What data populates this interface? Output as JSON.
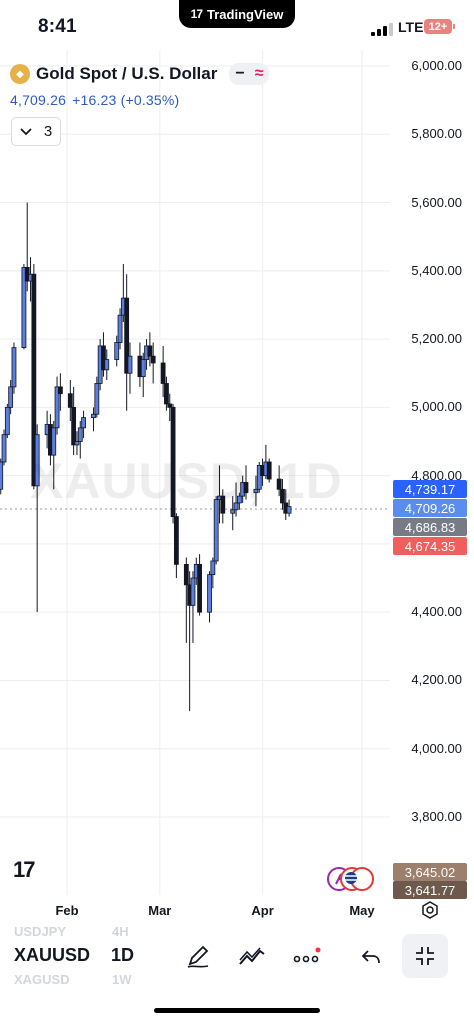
{
  "status": {
    "time": "8:41",
    "app_name": "TradingView",
    "network": "LTE",
    "battery": "12+"
  },
  "symbol": {
    "name": "Gold Spot / U.S. Dollar",
    "price": "4,709.26",
    "change": "+16.23 (+0.35%)",
    "indicator_count": "3"
  },
  "watermark": "XAUUSD, 1D",
  "price_tags": [
    {
      "label": "4,739.17",
      "color": "#2962ff"
    },
    {
      "label": "4,709.26",
      "color": "#5b8def"
    },
    {
      "label": "4,686.83",
      "color": "#787b86"
    },
    {
      "label": "4,674.35",
      "color": "#f05e5e"
    },
    {
      "label": "3,645.02",
      "color": "#9c7f6c"
    },
    {
      "label": "3,641.77",
      "color": "#6d5a4c"
    }
  ],
  "bottom": {
    "symbol": "XAUUSD",
    "interval": "1D",
    "ghost_above_symbol": "USDJPY",
    "ghost_above_interval": "4H",
    "ghost_below_symbol": "XAGUSD",
    "ghost_below_interval": "1W"
  },
  "colors": {
    "up": "#5b7fe0",
    "down": "#131722",
    "accent": "#2962ff"
  },
  "chart_data": {
    "type": "candlestick",
    "title": "Gold Spot / U.S. Dollar",
    "xlabel": "",
    "ylabel": "",
    "y_ticks": [
      6000,
      5800,
      5600,
      5400,
      5200,
      5000,
      4800,
      4600,
      4400,
      4200,
      4000,
      3800
    ],
    "y_tick_labels": [
      "6,000.00",
      "5,800.00",
      "5,600.00",
      "5,400.00",
      "5,200.00",
      "5,000.00",
      "4,800.00",
      "4,600.00",
      "4,400.00",
      "4,200.00",
      "4,000.00",
      "3,800.00"
    ],
    "ylim": [
      3700,
      6060
    ],
    "x_ticks": [
      {
        "label": "Feb",
        "date": "2026-02-01"
      },
      {
        "label": "Mar",
        "date": "2026-03-01"
      },
      {
        "label": "Apr",
        "date": "2026-04-01"
      },
      {
        "label": "May",
        "date": "2026-05-01"
      }
    ],
    "grid": true,
    "candles": [
      {
        "date": "2026-01-02",
        "o": 4630,
        "h": 4660,
        "l": 4610,
        "c": 4650
      },
      {
        "date": "2026-01-05",
        "o": 4650,
        "h": 4665,
        "l": 4615,
        "c": 4625
      },
      {
        "date": "2026-01-06",
        "o": 4625,
        "h": 4668,
        "l": 4605,
        "c": 4658
      },
      {
        "date": "2026-01-07",
        "o": 4658,
        "h": 4670,
        "l": 4620,
        "c": 4640
      },
      {
        "date": "2026-01-08",
        "o": 4640,
        "h": 4690,
        "l": 4630,
        "c": 4680
      },
      {
        "date": "2026-01-09",
        "o": 4680,
        "h": 4770,
        "l": 4670,
        "c": 4760
      },
      {
        "date": "2026-01-12",
        "o": 4760,
        "h": 4850,
        "l": 4745,
        "c": 4840
      },
      {
        "date": "2026-01-13",
        "o": 4840,
        "h": 4935,
        "l": 4830,
        "c": 4920
      },
      {
        "date": "2026-01-14",
        "o": 4920,
        "h": 5010,
        "l": 4910,
        "c": 5000
      },
      {
        "date": "2026-01-15",
        "o": 5000,
        "h": 5080,
        "l": 4980,
        "c": 5060
      },
      {
        "date": "2026-01-16",
        "o": 5060,
        "h": 5190,
        "l": 5040,
        "c": 5175
      },
      {
        "date": "2026-01-19",
        "o": 5175,
        "h": 5420,
        "l": 5170,
        "c": 5410
      },
      {
        "date": "2026-01-20",
        "o": 5410,
        "h": 5600,
        "l": 5340,
        "c": 5370
      },
      {
        "date": "2026-01-21",
        "o": 5370,
        "h": 5440,
        "l": 5310,
        "c": 5390
      },
      {
        "date": "2026-01-22",
        "o": 5390,
        "h": 5420,
        "l": 4760,
        "c": 4770
      },
      {
        "date": "2026-01-23",
        "o": 4770,
        "h": 4950,
        "l": 4400,
        "c": 4920
      },
      {
        "date": "2026-01-26",
        "o": 4920,
        "h": 4990,
        "l": 4880,
        "c": 4950
      },
      {
        "date": "2026-01-27",
        "o": 4950,
        "h": 4980,
        "l": 4830,
        "c": 4860
      },
      {
        "date": "2026-01-28",
        "o": 4860,
        "h": 4960,
        "l": 4760,
        "c": 4940
      },
      {
        "date": "2026-01-29",
        "o": 4940,
        "h": 5090,
        "l": 4920,
        "c": 5060
      },
      {
        "date": "2026-01-30",
        "o": 5060,
        "h": 5100,
        "l": 4990,
        "c": 5040
      },
      {
        "date": "2026-02-02",
        "o": 5040,
        "h": 5080,
        "l": 4960,
        "c": 5000
      },
      {
        "date": "2026-02-03",
        "o": 5000,
        "h": 5060,
        "l": 4860,
        "c": 4890
      },
      {
        "date": "2026-02-04",
        "o": 4890,
        "h": 4930,
        "l": 4860,
        "c": 4900
      },
      {
        "date": "2026-02-05",
        "o": 4900,
        "h": 4960,
        "l": 4850,
        "c": 4940
      },
      {
        "date": "2026-02-06",
        "o": 4940,
        "h": 4990,
        "l": 4910,
        "c": 4970
      },
      {
        "date": "2026-02-09",
        "o": 4970,
        "h": 5000,
        "l": 4930,
        "c": 4980
      },
      {
        "date": "2026-02-10",
        "o": 4980,
        "h": 5090,
        "l": 4970,
        "c": 5070
      },
      {
        "date": "2026-02-11",
        "o": 5070,
        "h": 5200,
        "l": 5050,
        "c": 5180
      },
      {
        "date": "2026-02-12",
        "o": 5180,
        "h": 5220,
        "l": 5090,
        "c": 5110
      },
      {
        "date": "2026-02-13",
        "o": 5110,
        "h": 5170,
        "l": 5080,
        "c": 5140
      },
      {
        "date": "2026-02-16",
        "o": 5140,
        "h": 5210,
        "l": 5120,
        "c": 5190
      },
      {
        "date": "2026-02-17",
        "o": 5190,
        "h": 5290,
        "l": 5170,
        "c": 5270
      },
      {
        "date": "2026-02-18",
        "o": 5270,
        "h": 5420,
        "l": 5250,
        "c": 5320
      },
      {
        "date": "2026-02-19",
        "o": 5320,
        "h": 5390,
        "l": 4990,
        "c": 5100
      },
      {
        "date": "2026-02-20",
        "o": 5100,
        "h": 5190,
        "l": 5040,
        "c": 5150
      },
      {
        "date": "2026-02-23",
        "o": 5150,
        "h": 5190,
        "l": 5060,
        "c": 5090
      },
      {
        "date": "2026-02-24",
        "o": 5090,
        "h": 5160,
        "l": 5030,
        "c": 5140
      },
      {
        "date": "2026-02-25",
        "o": 5140,
        "h": 5200,
        "l": 5110,
        "c": 5180
      },
      {
        "date": "2026-02-26",
        "o": 5180,
        "h": 5220,
        "l": 5120,
        "c": 5150
      },
      {
        "date": "2026-02-27",
        "o": 5150,
        "h": 5190,
        "l": 5070,
        "c": 5130
      },
      {
        "date": "2026-03-02",
        "o": 5130,
        "h": 5180,
        "l": 5030,
        "c": 5070
      },
      {
        "date": "2026-03-03",
        "o": 5070,
        "h": 5090,
        "l": 4990,
        "c": 5010
      },
      {
        "date": "2026-03-04",
        "o": 5010,
        "h": 5040,
        "l": 4960,
        "c": 5000
      },
      {
        "date": "2026-03-05",
        "o": 5000,
        "h": 5010,
        "l": 4660,
        "c": 4680
      },
      {
        "date": "2026-03-06",
        "o": 4680,
        "h": 4690,
        "l": 4500,
        "c": 4540
      },
      {
        "date": "2026-03-09",
        "o": 4540,
        "h": 4560,
        "l": 4310,
        "c": 4480
      },
      {
        "date": "2026-03-10",
        "o": 4480,
        "h": 4520,
        "l": 4110,
        "c": 4420
      },
      {
        "date": "2026-03-11",
        "o": 4420,
        "h": 4520,
        "l": 4310,
        "c": 4500
      },
      {
        "date": "2026-03-12",
        "o": 4500,
        "h": 4560,
        "l": 4480,
        "c": 4540
      },
      {
        "date": "2026-03-13",
        "o": 4540,
        "h": 4570,
        "l": 4390,
        "c": 4400
      },
      {
        "date": "2026-03-16",
        "o": 4400,
        "h": 4520,
        "l": 4370,
        "c": 4510
      },
      {
        "date": "2026-03-17",
        "o": 4510,
        "h": 4560,
        "l": 4470,
        "c": 4550
      },
      {
        "date": "2026-03-18",
        "o": 4550,
        "h": 4740,
        "l": 4540,
        "c": 4730
      },
      {
        "date": "2026-03-19",
        "o": 4730,
        "h": 4830,
        "l": 4660,
        "c": 4740
      },
      {
        "date": "2026-03-20",
        "o": 4740,
        "h": 4760,
        "l": 4660,
        "c": 4690
      },
      {
        "date": "2026-03-23",
        "o": 4690,
        "h": 4740,
        "l": 4640,
        "c": 4700
      },
      {
        "date": "2026-03-24",
        "o": 4700,
        "h": 4780,
        "l": 4680,
        "c": 4720
      },
      {
        "date": "2026-03-25",
        "o": 4720,
        "h": 4750,
        "l": 4700,
        "c": 4740
      },
      {
        "date": "2026-03-26",
        "o": 4740,
        "h": 4800,
        "l": 4720,
        "c": 4780
      },
      {
        "date": "2026-03-27",
        "o": 4780,
        "h": 4830,
        "l": 4730,
        "c": 4750
      },
      {
        "date": "2026-03-30",
        "o": 4750,
        "h": 4800,
        "l": 4710,
        "c": 4760
      },
      {
        "date": "2026-03-31",
        "o": 4760,
        "h": 4840,
        "l": 4750,
        "c": 4830
      },
      {
        "date": "2026-04-01",
        "o": 4830,
        "h": 4850,
        "l": 4770,
        "c": 4800
      },
      {
        "date": "2026-04-02",
        "o": 4800,
        "h": 4890,
        "l": 4790,
        "c": 4840
      },
      {
        "date": "2026-04-03",
        "o": 4840,
        "h": 4850,
        "l": 4780,
        "c": 4790
      },
      {
        "date": "2026-04-06",
        "o": 4790,
        "h": 4830,
        "l": 4740,
        "c": 4760
      },
      {
        "date": "2026-04-07",
        "o": 4760,
        "h": 4790,
        "l": 4700,
        "c": 4720
      },
      {
        "date": "2026-04-08",
        "o": 4720,
        "h": 4760,
        "l": 4670,
        "c": 4690
      },
      {
        "date": "2026-04-09",
        "o": 4690,
        "h": 4730,
        "l": 4680,
        "c": 4709.26
      }
    ]
  }
}
